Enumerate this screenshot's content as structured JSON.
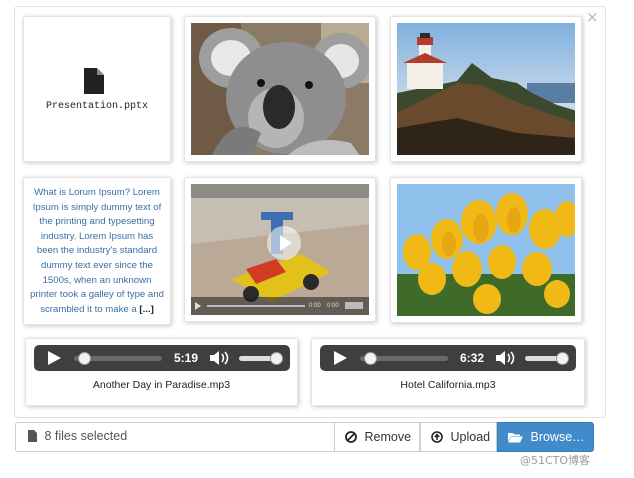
{
  "previews": {
    "file": {
      "name": "Presentation.pptx",
      "icon": "file-icon"
    },
    "text": {
      "body": "What is Lorum Ipsum? Lorem Ipsum is simply dummy text of the printing and typesetting industry. Lorem Ipsum has been the industry's standard dummy text ever since the 1500s, when an unknown printer took a galley of type and scrambled it to make a",
      "more": "[...]"
    },
    "images": [
      "koala-photo",
      "lighthouse-photo",
      "tulips-photo"
    ],
    "video": {
      "current": "0:00",
      "duration": "0:00"
    },
    "audio": [
      {
        "time": "5:19",
        "name": "Another Day in Paradise.mp3"
      },
      {
        "time": "6:32",
        "name": "Hotel California.mp3"
      }
    ]
  },
  "close_label": "×",
  "caption": {
    "text": "8 files selected",
    "icon": "file-icon"
  },
  "buttons": {
    "remove": {
      "label": "Remove",
      "icon": "ban-icon"
    },
    "upload": {
      "label": "Upload",
      "icon": "upload-icon"
    },
    "browse": {
      "label": "Browse…",
      "icon": "folder-open-icon"
    }
  },
  "watermark": "@51CTO博客",
  "colors": {
    "browse": "#428bca",
    "text_preview": "#3a6ea5"
  }
}
